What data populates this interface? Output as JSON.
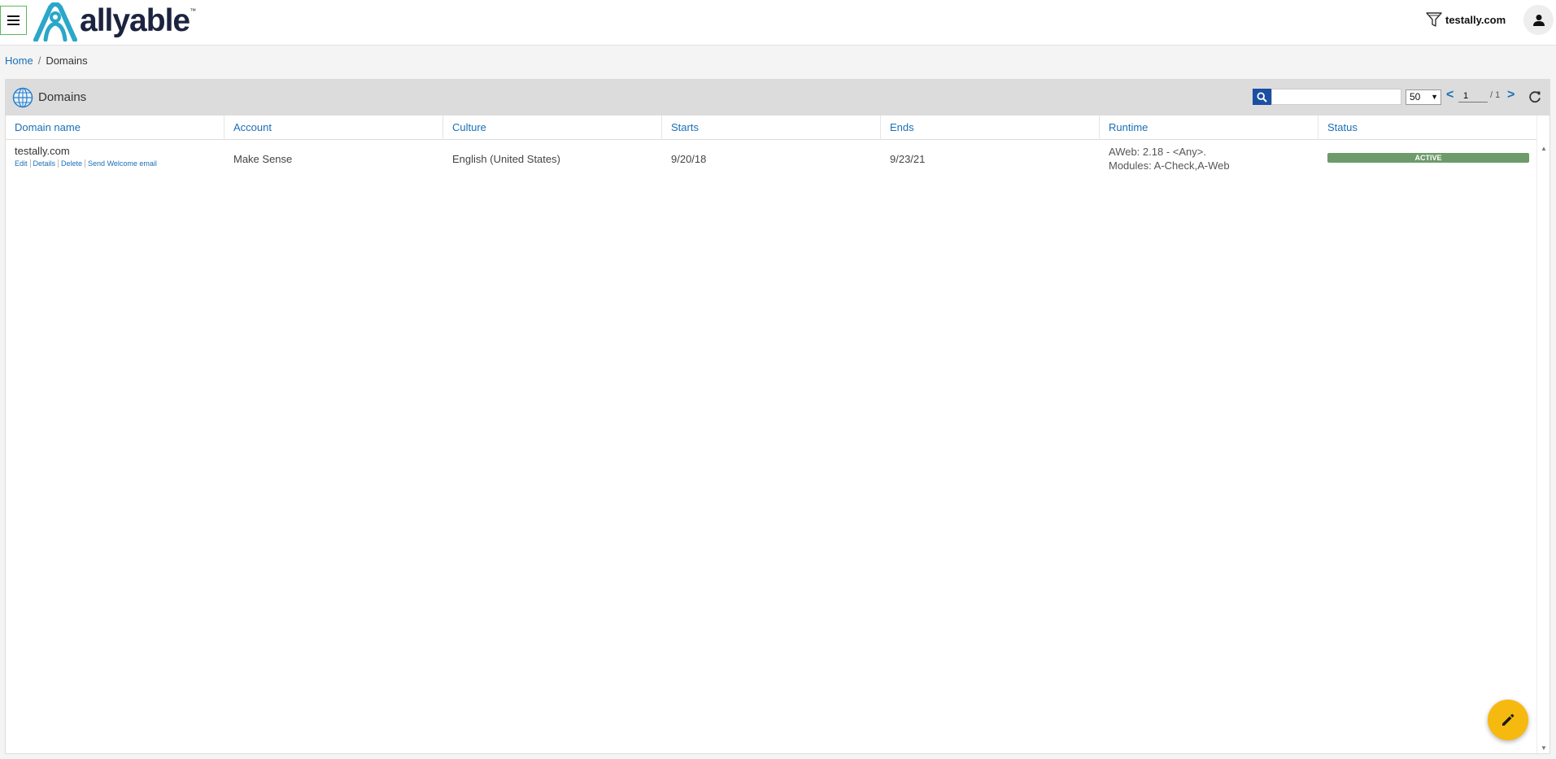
{
  "header": {
    "logo_text": "allyable",
    "logo_tm": "™",
    "filter_label": "testally.com"
  },
  "breadcrumb": {
    "home": "Home",
    "separator": "/",
    "current": "Domains"
  },
  "panel": {
    "title": "Domains",
    "search": {
      "placeholder": "",
      "value": ""
    },
    "page_size": "50",
    "pager": {
      "prev": "<",
      "current": "1",
      "total": "/ 1",
      "next": ">"
    }
  },
  "table": {
    "columns": [
      "Domain name",
      "Account",
      "Culture",
      "Starts",
      "Ends",
      "Runtime",
      "Status"
    ],
    "rows": [
      {
        "domain": "testally.com",
        "actions": [
          "Edit",
          "Details",
          "Delete",
          "Send Welcome email"
        ],
        "account": "Make Sense",
        "culture": "English (United States)",
        "starts": "9/20/18",
        "ends": "9/23/21",
        "runtime_line1": "AWeb: 2.18 - <Any>.",
        "runtime_line2": "Modules: A-Check,A-Web",
        "status": "ACTIVE"
      }
    ]
  },
  "icons": {
    "menu": "hamburger-icon",
    "filter": "funnel-icon",
    "user": "user-icon",
    "globe": "globe-icon",
    "search": "search-icon",
    "refresh": "refresh-icon",
    "fab": "pencil-icon"
  },
  "colors": {
    "link": "#1a6fb5",
    "brand_teal": "#2aa7c9",
    "brand_navy": "#1c2340",
    "status_active": "#6d9b6a",
    "fab": "#f6b90f",
    "search_button": "#1a4fa3"
  }
}
